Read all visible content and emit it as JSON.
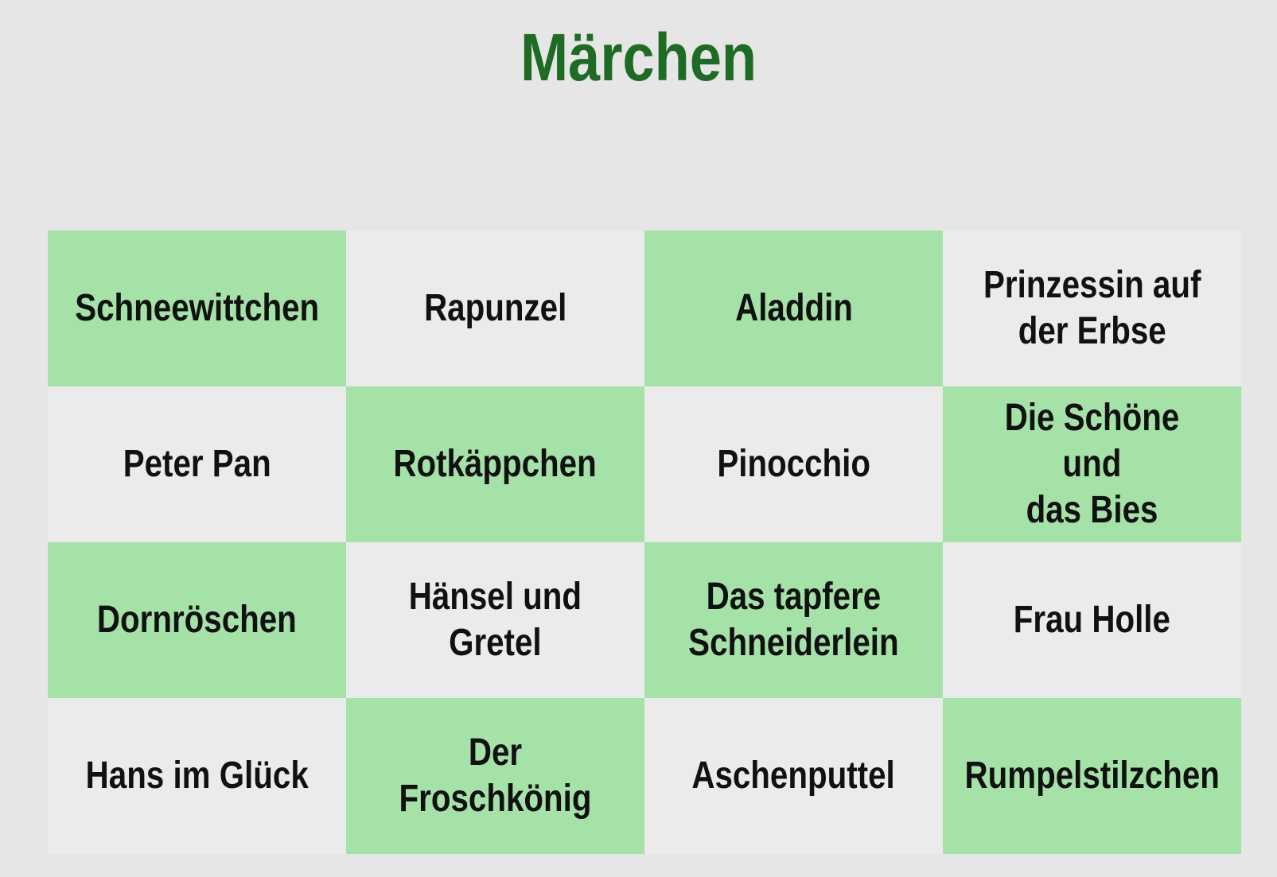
{
  "title": "Märchen",
  "colors": {
    "title": "#1e6b24",
    "green_cell": "#a4e2a7",
    "plain_cell": "#ebebec",
    "background": "#e6e6e7"
  },
  "cells": [
    {
      "label": "Schneewittchen",
      "color": "green"
    },
    {
      "label": "Rapunzel",
      "color": "plain"
    },
    {
      "label": "Aladdin",
      "color": "green"
    },
    {
      "label": "Prinzessin auf\nder Erbse",
      "color": "plain"
    },
    {
      "label": "Peter Pan",
      "color": "plain"
    },
    {
      "label": "Rotkäppchen",
      "color": "green"
    },
    {
      "label": "Pinocchio",
      "color": "plain"
    },
    {
      "label": "Die Schöne und\ndas Bies",
      "color": "green"
    },
    {
      "label": "Dornröschen",
      "color": "green"
    },
    {
      "label": "Hänsel und\nGretel",
      "color": "plain"
    },
    {
      "label": "Das tapfere\nSchneiderlein",
      "color": "green"
    },
    {
      "label": "Frau Holle",
      "color": "plain"
    },
    {
      "label": "Hans im Glück",
      "color": "plain"
    },
    {
      "label": "Der Froschkönig",
      "color": "green"
    },
    {
      "label": "Aschenputtel",
      "color": "plain"
    },
    {
      "label": "Rumpelstilzchen",
      "color": "green"
    }
  ]
}
